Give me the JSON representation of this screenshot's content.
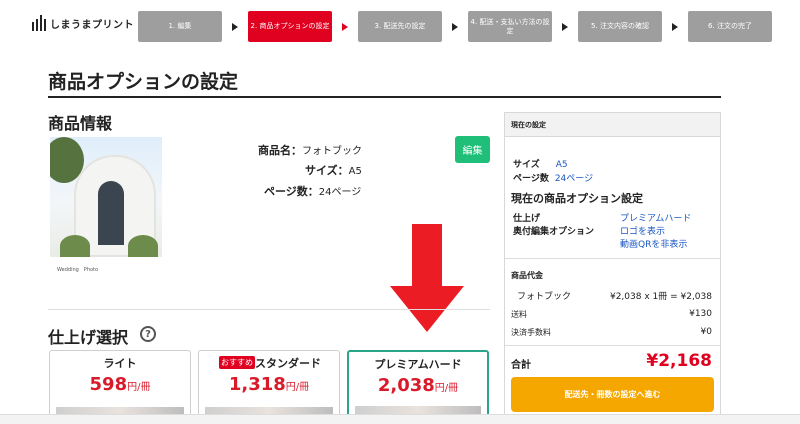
{
  "header": {
    "logo_text": "しまうまプリント",
    "steps": [
      {
        "label": "1. 編集"
      },
      {
        "label": "2. 商品オプションの設定"
      },
      {
        "label": "3. 配送先の設定"
      },
      {
        "label": "4. 配送・支払い方法の設定"
      },
      {
        "label": "5. 注文内容の確認"
      },
      {
        "label": "6. 注文の完了"
      }
    ]
  },
  "page_title": "商品オプションの設定",
  "product": {
    "section_title": "商品情報",
    "photo_caption": "Wedding　Photo",
    "name_label": "商品名：",
    "name_value": "フォトブック",
    "size_label": "サイズ：",
    "size_value": "A5",
    "pages_label": "ページ数：",
    "pages_value": "24ページ",
    "edit_label": "編集"
  },
  "finish": {
    "section_title": "仕上げ選択",
    "help_glyph": "?",
    "options": [
      {
        "name": "ライト",
        "price": "598",
        "unit": "円/冊",
        "badge": ""
      },
      {
        "name": "スタンダード",
        "price": "1,318",
        "unit": "円/冊",
        "badge": "おすすめ"
      },
      {
        "name": "プレミアムハード",
        "price": "2,038",
        "unit": "円/冊",
        "badge": ""
      }
    ]
  },
  "sidebar": {
    "header": "現在の設定",
    "size_label": "サイズ",
    "size_value": "A5",
    "pages_label": "ページ数",
    "pages_value": "24ページ",
    "options_title": "現在の商品オプション設定",
    "finish_label": "仕上げ",
    "finish_value": "プレミアムハード",
    "colophon_label": "奥付編集オプション",
    "colophon_value_1": "ロゴを表示",
    "colophon_value_2": "動画QRを非表示",
    "price_title": "商品代金",
    "item_label": "フォトブック",
    "item_calc": "¥2,038 x 1冊 = ¥2,038",
    "shipping_label": "送料",
    "shipping_value": "¥130",
    "fee_label": "決済手数料",
    "fee_value": "¥0",
    "total_label": "合計",
    "total_value": "¥2,168",
    "cta_label": "配送先・冊数の設定へ進む"
  },
  "colors": {
    "active_step": "#e00020",
    "inactive_step": "#9e9e9e",
    "price_red": "#d81a2a",
    "edit_green": "#1fbf7a",
    "cta_orange": "#f5a700",
    "link_blue": "#1a56c4",
    "selected_border": "#2aa58a"
  }
}
